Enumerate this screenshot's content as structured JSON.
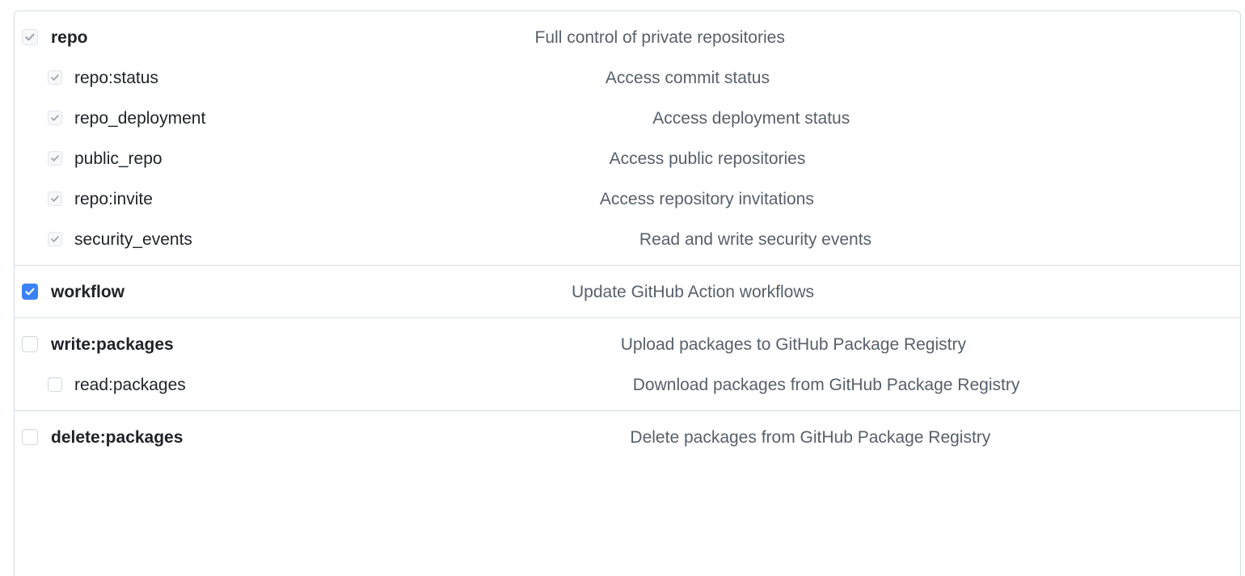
{
  "panel": {
    "name": "oauth-scopes-selector",
    "colors": {
      "accent_checked": "#3b82f6",
      "border": "#d8dee4",
      "label_text": "#1f2328",
      "description_text": "#57606a",
      "disabled_checkbox_bg": "#f6f8fa",
      "disabled_checkmark": "#a0a6ad"
    }
  },
  "groups": [
    {
      "id": "repo-group",
      "rows": [
        {
          "level": "parent",
          "name": "repo",
          "label": "repo",
          "description": "Full control of private repositories",
          "state": "disabled-checked",
          "checkbox_icon": "checkbox-checked-disabled-icon"
        },
        {
          "level": "child",
          "name": "repo-status",
          "label": "repo:status",
          "description": "Access commit status",
          "state": "disabled-checked",
          "checkbox_icon": "checkbox-checked-disabled-icon"
        },
        {
          "level": "child",
          "name": "repo-deployment",
          "label": "repo_deployment",
          "description": "Access deployment status",
          "state": "disabled-checked",
          "checkbox_icon": "checkbox-checked-disabled-icon"
        },
        {
          "level": "child",
          "name": "public-repo",
          "label": "public_repo",
          "description": "Access public repositories",
          "state": "disabled-checked",
          "checkbox_icon": "checkbox-checked-disabled-icon"
        },
        {
          "level": "child",
          "name": "repo-invite",
          "label": "repo:invite",
          "description": "Access repository invitations",
          "state": "disabled-checked",
          "checkbox_icon": "checkbox-checked-disabled-icon"
        },
        {
          "level": "child",
          "name": "security-events",
          "label": "security_events",
          "description": "Read and write security events",
          "state": "disabled-checked",
          "checkbox_icon": "checkbox-checked-disabled-icon"
        }
      ]
    },
    {
      "id": "workflow-group",
      "rows": [
        {
          "level": "parent",
          "name": "workflow",
          "label": "workflow",
          "description": "Update GitHub Action workflows",
          "state": "checked",
          "checkbox_icon": "checkbox-checked-icon"
        }
      ]
    },
    {
      "id": "packages-group",
      "rows": [
        {
          "level": "parent",
          "name": "write-packages",
          "label": "write:packages",
          "description": "Upload packages to GitHub Package Registry",
          "state": "unchecked",
          "checkbox_icon": "checkbox-unchecked-icon"
        },
        {
          "level": "child",
          "name": "read-packages",
          "label": "read:packages",
          "description": "Download packages from GitHub Package Registry",
          "state": "unchecked",
          "checkbox_icon": "checkbox-unchecked-icon"
        }
      ]
    },
    {
      "id": "delete-packages-group",
      "rows": [
        {
          "level": "parent",
          "name": "delete-packages",
          "label": "delete:packages",
          "description": "Delete packages from GitHub Package Registry",
          "state": "unchecked",
          "checkbox_icon": "checkbox-unchecked-icon"
        }
      ]
    }
  ]
}
